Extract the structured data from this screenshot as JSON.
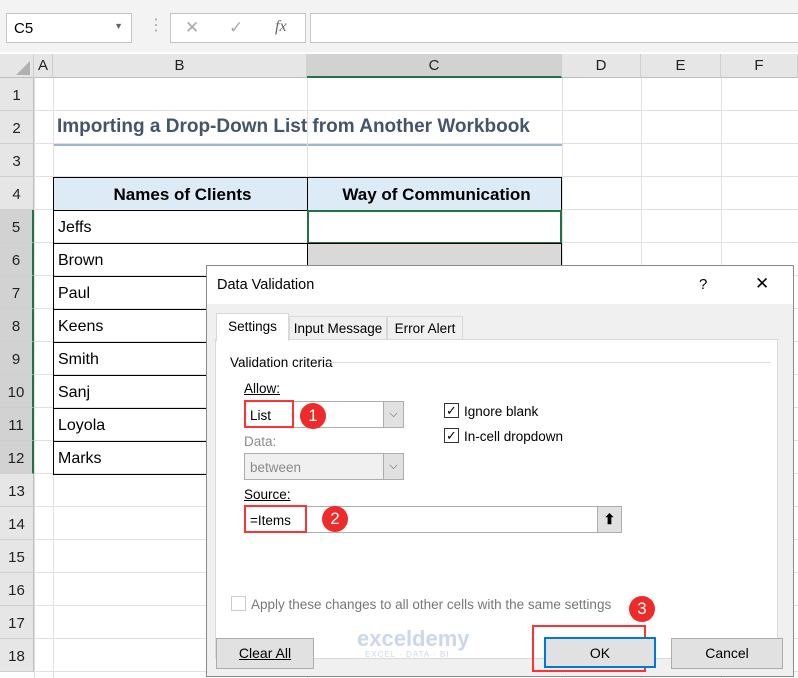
{
  "formula_bar": {
    "name_box": "C5",
    "cancel_icon": "✕",
    "enter_icon": "✓",
    "fx": "fx",
    "formula": ""
  },
  "columns": [
    "A",
    "B",
    "C",
    "D",
    "E",
    "F"
  ],
  "rows": [
    "1",
    "2",
    "3",
    "4",
    "5",
    "6",
    "7",
    "8",
    "9",
    "10",
    "11",
    "12",
    "13",
    "14",
    "15",
    "16",
    "17",
    "18"
  ],
  "sheet": {
    "title": "Importing a Drop-Down List from Another Workbook",
    "headers": [
      "Names of Clients",
      "Way of Communication"
    ],
    "clients": [
      "Jeffs",
      "Brown",
      "Paul",
      "Keens",
      "Smith",
      "Sanj",
      "Loyola",
      "Marks"
    ]
  },
  "dialog": {
    "title": "Data Validation",
    "help": "?",
    "close": "✕",
    "tabs": [
      "Settings",
      "Input Message",
      "Error Alert"
    ],
    "group": "Validation criteria",
    "allow_label": "Allow:",
    "allow_value": "List",
    "data_label": "Data:",
    "data_value": "between",
    "source_label": "Source:",
    "source_value": "=Items",
    "ignore_blank": "Ignore blank",
    "in_cell": "In-cell dropdown",
    "apply_all": "Apply these changes to all other cells with the same settings",
    "clear_all": "Clear All",
    "ok": "OK",
    "cancel": "Cancel",
    "badges": [
      "1",
      "2",
      "3"
    ],
    "watermark": "exceldemy",
    "watermark_sub": "EXCEL · DATA · BI"
  },
  "colors": {
    "accent": "#217346",
    "annotation": "#ff3333"
  }
}
